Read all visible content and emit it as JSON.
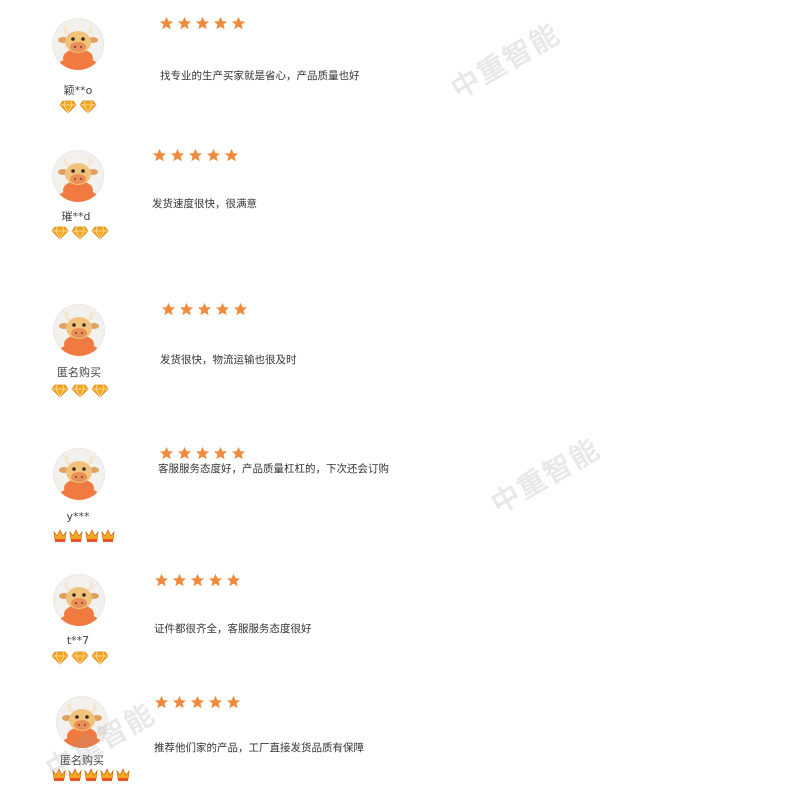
{
  "colors": {
    "star": "#f08a3c",
    "gem": "#f5a623",
    "crown": "#e8552b",
    "avatar_face": "#f07a40"
  },
  "watermark": "中重智能",
  "reviews": [
    {
      "username": "颖**o",
      "stars": 5,
      "badge_icon": "diamond-icon",
      "badge_count": 2,
      "comment": "找专业的生产买家就是省心，产品质量也好"
    },
    {
      "username": "璀**d",
      "stars": 5,
      "badge_icon": "diamond-icon",
      "badge_count": 3,
      "comment": "发货速度很快，很满意"
    },
    {
      "username": "匿名购买",
      "stars": 5,
      "badge_icon": "diamond-icon",
      "badge_count": 3,
      "comment": "发货很快，物流运输也很及时"
    },
    {
      "username": "y***",
      "stars": 5,
      "badge_icon": "crown-icon",
      "badge_count": 4,
      "comment": "客服服务态度好，产品质量杠杠的，下次还会订购"
    },
    {
      "username": "t**7",
      "stars": 5,
      "badge_icon": "diamond-icon",
      "badge_count": 3,
      "comment": "证件都很齐全，客服服务态度很好"
    },
    {
      "username": "匿名购买",
      "stars": 5,
      "badge_icon": "crown-icon",
      "badge_count": 5,
      "comment": "推荐他们家的产品，工厂直接发货品质有保障"
    }
  ]
}
